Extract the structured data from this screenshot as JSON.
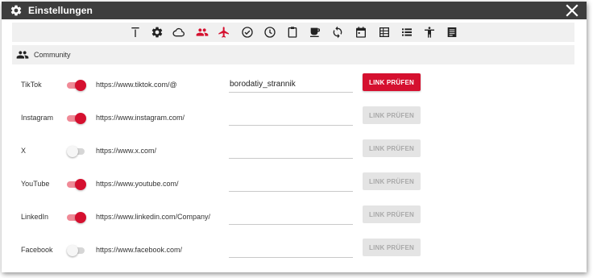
{
  "window": {
    "title": "Einstellungen"
  },
  "toolbar": {
    "icons": [
      {
        "name": "text-top-icon",
        "active": false
      },
      {
        "name": "gear-icon",
        "active": false
      },
      {
        "name": "cloud-icon",
        "active": false
      },
      {
        "name": "people-icon",
        "active": true
      },
      {
        "name": "airplane-icon",
        "active": false
      },
      {
        "name": "check-circle-icon",
        "active": false
      },
      {
        "name": "clock-icon",
        "active": false
      },
      {
        "name": "clipboard-icon",
        "active": false
      },
      {
        "name": "coffee-icon",
        "active": false
      },
      {
        "name": "sync-icon",
        "active": false
      },
      {
        "name": "calendar-icon",
        "active": false
      },
      {
        "name": "table-icon",
        "active": false
      },
      {
        "name": "list-icon",
        "active": false
      },
      {
        "name": "accessibility-icon",
        "active": false
      },
      {
        "name": "document-icon",
        "active": false
      }
    ]
  },
  "section": {
    "label": "Community",
    "icon": "people-icon"
  },
  "accounts": [
    {
      "platform": "TikTok",
      "enabled": true,
      "url": "https://www.tiktok.com/@",
      "value": "borodatiy_strannik",
      "button": "LINK PRÜFEN",
      "button_active": true
    },
    {
      "platform": "Instagram",
      "enabled": true,
      "url": "https://www.instagram.com/",
      "value": "",
      "button": "LINK PRÜFEN",
      "button_active": false
    },
    {
      "platform": "X",
      "enabled": false,
      "url": "https://www.x.com/",
      "value": "",
      "button": "LINK PRÜFEN",
      "button_active": false
    },
    {
      "platform": "YouTube",
      "enabled": true,
      "url": "https://www.youtube.com/",
      "value": "",
      "button": "LINK PRÜFEN",
      "button_active": false
    },
    {
      "platform": "LinkedIn",
      "enabled": true,
      "url": "https://www.linkedin.com/Company/",
      "value": "",
      "button": "LINK PRÜFEN",
      "button_active": false
    },
    {
      "platform": "Facebook",
      "enabled": false,
      "url": "https://www.facebook.com/",
      "value": "",
      "button": "LINK PRÜFEN",
      "button_active": false
    }
  ],
  "colors": {
    "accent": "#d5102f",
    "titlebar": "#3d3d3d",
    "toolbar_bg": "#f0f0f0",
    "icon": "#222222"
  }
}
